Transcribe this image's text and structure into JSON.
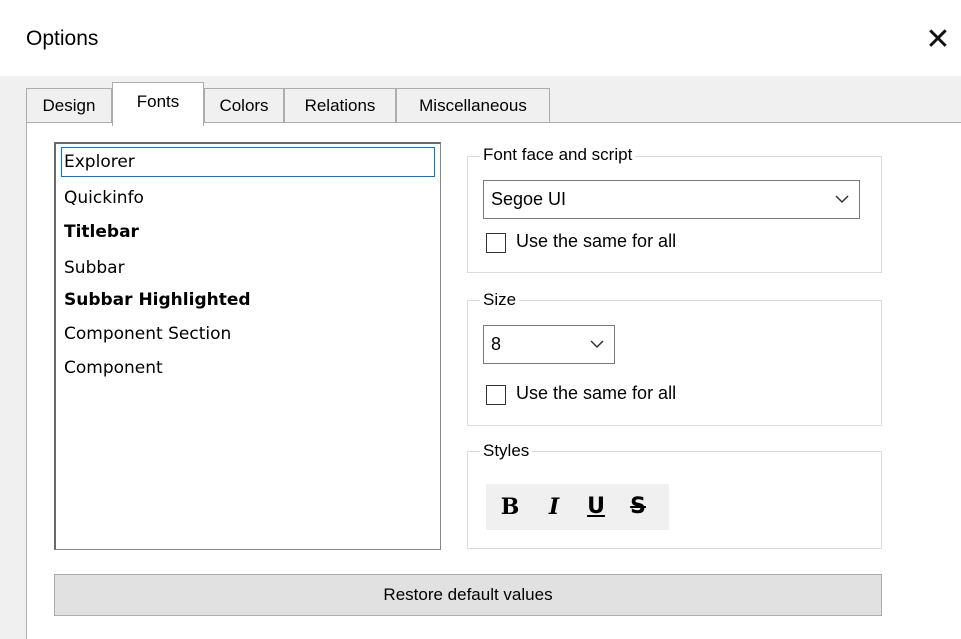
{
  "window": {
    "title": "Options",
    "close_icon": "close-icon"
  },
  "tabs": [
    {
      "label": "Design",
      "active": false
    },
    {
      "label": "Fonts",
      "active": true
    },
    {
      "label": "Colors",
      "active": false
    },
    {
      "label": "Relations",
      "active": false
    },
    {
      "label": "Miscellaneous",
      "active": false
    }
  ],
  "font_list": {
    "items": [
      {
        "label": "Explorer",
        "bold": false,
        "selected": true
      },
      {
        "label": "Quickinfo",
        "bold": false,
        "selected": false
      },
      {
        "label": "Titlebar",
        "bold": true,
        "selected": false
      },
      {
        "label": "Subbar",
        "bold": false,
        "selected": false
      },
      {
        "label": "Subbar Highlighted",
        "bold": true,
        "selected": false
      },
      {
        "label": "Component Section",
        "bold": false,
        "selected": false
      },
      {
        "label": "Component",
        "bold": false,
        "selected": false
      }
    ]
  },
  "font_face": {
    "legend": "Font face and script",
    "value": "Segoe UI",
    "same_for_all_label": "Use the same for all",
    "same_for_all_checked": false
  },
  "size": {
    "legend": "Size",
    "value": "8",
    "same_for_all_label": "Use the same for all",
    "same_for_all_checked": false
  },
  "styles": {
    "legend": "Styles",
    "bold_label": "B",
    "italic_label": "I",
    "underline_label": "U",
    "strike_label": "S"
  },
  "restore_label": "Restore default values",
  "colors": {
    "accent": "#0078d7",
    "window_bg": "#f0f0f0"
  }
}
